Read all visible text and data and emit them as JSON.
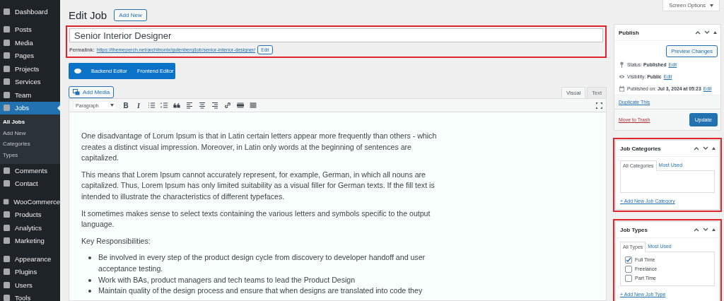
{
  "sidebar": {
    "groups": [
      [
        {
          "label": "Dashboard",
          "selected": false
        }
      ],
      [
        {
          "label": "Posts",
          "selected": false
        },
        {
          "label": "Media",
          "selected": false
        },
        {
          "label": "Pages",
          "selected": false
        },
        {
          "label": "Projects",
          "selected": false
        },
        {
          "label": "Services",
          "selected": false
        },
        {
          "label": "Team",
          "selected": false
        },
        {
          "label": "Jobs",
          "selected": true,
          "children": [
            {
              "label": "All Jobs",
              "selected": true
            },
            {
              "label": "Add New",
              "selected": false
            },
            {
              "label": "Categories",
              "selected": false
            },
            {
              "label": "Types",
              "selected": false
            }
          ]
        },
        {
          "label": "Comments",
          "selected": false
        },
        {
          "label": "Contact",
          "selected": false
        }
      ],
      [
        {
          "label": "WooCommerce",
          "selected": false
        },
        {
          "label": "Products",
          "selected": false
        },
        {
          "label": "Analytics",
          "selected": false
        },
        {
          "label": "Marketing",
          "selected": false
        }
      ],
      [
        {
          "label": "Appearance",
          "selected": false
        },
        {
          "label": "Plugins",
          "selected": false
        },
        {
          "label": "Users",
          "selected": false
        },
        {
          "label": "Tools",
          "selected": false
        }
      ]
    ]
  },
  "header": {
    "title": "Edit Job",
    "add_new": "Add New"
  },
  "screen_options": "Screen Options",
  "title_field": {
    "value": "Senior Interior Designer",
    "highlighted": true
  },
  "permalink": {
    "label": "Permalink:",
    "url": "https://themeperch.net/architronix/gutenberg/job/senior-interior-designer/",
    "edit": "Edit"
  },
  "builder_bar": {
    "buttons": [
      "Backend Editor",
      "Frontend Editor"
    ]
  },
  "add_media": "Add Media",
  "editor_tabs": [
    {
      "label": "Visual",
      "selected": true
    },
    {
      "label": "Text",
      "selected": false
    }
  ],
  "format_select": "Paragraph",
  "toolbar": [
    {
      "kind": "bold",
      "glyph": "B"
    },
    {
      "kind": "italic",
      "glyph": "I"
    },
    {
      "kind": "bullet-list"
    },
    {
      "kind": "numbered-list"
    },
    {
      "kind": "quote"
    },
    {
      "kind": "align-left"
    },
    {
      "kind": "align-center"
    },
    {
      "kind": "align-right"
    },
    {
      "kind": "link"
    },
    {
      "kind": "more"
    },
    {
      "kind": "toolbar-toggle"
    }
  ],
  "content": [
    {
      "kind": "paragraph",
      "text": "One disadvantage of Lorum Ipsum is that in Latin certain letters appear more frequently than others - which creates a distinct visual impression. Moreover, in Latin only words at the beginning of sentences are capitalized."
    },
    {
      "kind": "paragraph",
      "text": "This means that Lorem Ipsum cannot accurately represent, for example, German, in which all nouns are capitalized. Thus, Lorem Ipsum has only limited suitability as a visual filler for German texts. If the fill text is intended to illustrate the characteristics of different typefaces."
    },
    {
      "kind": "paragraph",
      "text": "It sometimes makes sense to select texts containing the various letters and symbols specific to the output language."
    },
    {
      "kind": "paragraph",
      "text": "Key Responsibilities:"
    },
    {
      "kind": "list",
      "items": [
        "Be involved in every step of the product design cycle from discovery to developer handoff and user acceptance testing.",
        "Work with BAs, product managers and tech teams to lead the Product Design",
        "Maintain quality of the design process and ensure that when designs are translated into code they"
      ]
    }
  ],
  "publish": {
    "title": "Publish",
    "preview": "Preview Changes",
    "rows": [
      {
        "kind": "status",
        "label": "Status:",
        "value": "Published",
        "link": "Edit"
      },
      {
        "kind": "visibility",
        "label": "Visibility:",
        "value": "Public",
        "link": "Edit"
      },
      {
        "kind": "date",
        "label": "Published on:",
        "value": "Jul 3, 2024 at 05:23",
        "link": "Edit"
      }
    ],
    "duplicate": "Duplicate This",
    "trash": "Move to Trash",
    "update": "Update"
  },
  "job_categories": {
    "title": "Job Categories",
    "highlighted": true,
    "tabs": [
      {
        "label": "All Categories",
        "selected": true
      },
      {
        "label": "Most Used",
        "selected": false
      }
    ],
    "add_link": "+ Add New Job Category"
  },
  "job_types": {
    "title": "Job Types",
    "highlighted": true,
    "tabs": [
      {
        "label": "All Types",
        "selected": true
      },
      {
        "label": "Most Used",
        "selected": false
      }
    ],
    "items": [
      {
        "label": "Full Time",
        "checked": true
      },
      {
        "label": "Freelance",
        "checked": false
      },
      {
        "label": "Part Time",
        "checked": false
      }
    ],
    "add_link": "+ Add New Job Type"
  }
}
